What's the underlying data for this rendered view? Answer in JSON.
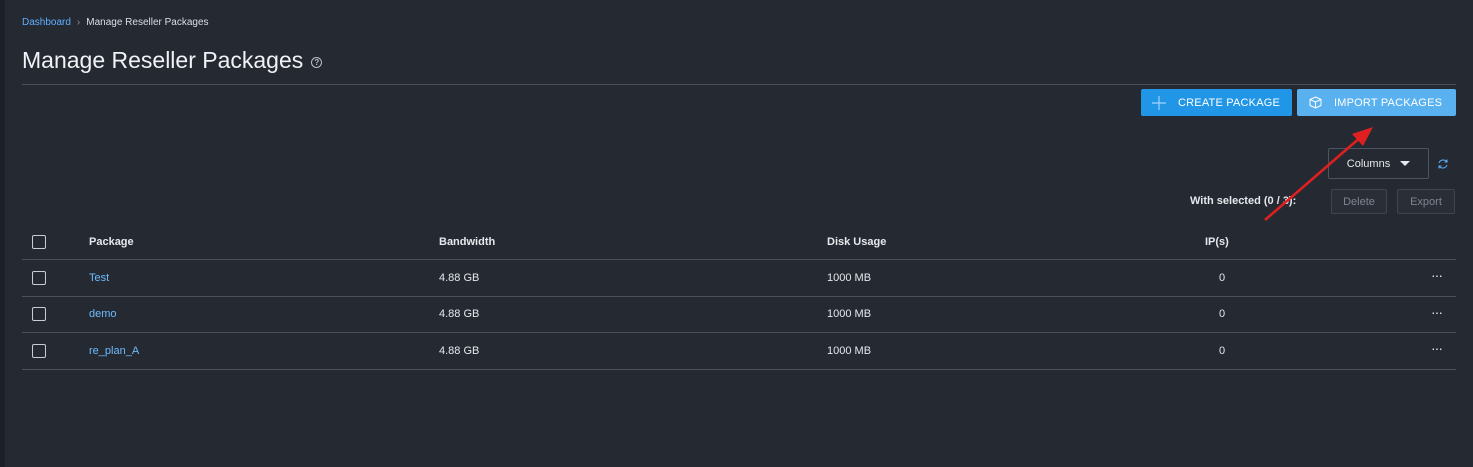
{
  "breadcrumb": {
    "home": "Dashboard",
    "separator": "›",
    "current": "Manage Reseller Packages"
  },
  "page": {
    "title": "Manage Reseller Packages",
    "help_icon": "?"
  },
  "toolbar": {
    "create_label": "CREATE PACKAGE",
    "import_label": "IMPORT PACKAGES",
    "columns_label": "Columns",
    "with_selected": "With selected (0 / 3):",
    "delete_label": "Delete",
    "export_label": "Export"
  },
  "table": {
    "headers": [
      "Package",
      "Bandwidth",
      "Disk Usage",
      "IP(s)"
    ],
    "rows": [
      {
        "package": "Test",
        "bandwidth": "4.88 GB",
        "disk": "1000 MB",
        "ips": "0"
      },
      {
        "package": "demo",
        "bandwidth": "4.88 GB",
        "disk": "1000 MB",
        "ips": "0"
      },
      {
        "package": "re_plan_A",
        "bandwidth": "4.88 GB",
        "disk": "1000 MB",
        "ips": "0"
      }
    ],
    "more_icon": "···"
  },
  "colors": {
    "background": "#252932",
    "primary": "#2196e6",
    "primary_light": "#59b2ef",
    "link": "#6cbcff",
    "annotation": "#e02020"
  },
  "icons": {
    "create": "plus-icon",
    "import": "box-icon",
    "columns": "caret-down-icon",
    "refresh": "refresh-icon",
    "more": "ellipsis-icon"
  }
}
